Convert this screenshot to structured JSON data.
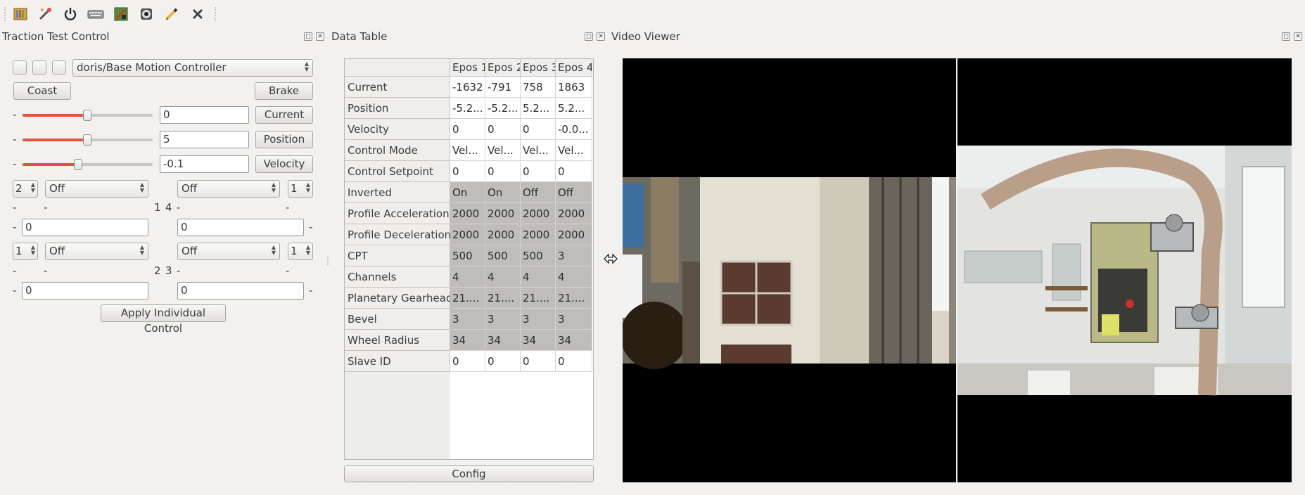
{
  "toolbar": {
    "icons": [
      "book-icon",
      "magic-wand-icon",
      "power-icon",
      "keyboard-icon",
      "terminal-icon",
      "webcam-icon",
      "pencil-icon",
      "close-icon"
    ]
  },
  "traction": {
    "title": "Traction Test Control",
    "controller": "doris/Base Motion Controller",
    "coast": "Coast",
    "brake": "Brake",
    "sliders": [
      {
        "minus": "-",
        "value": "0",
        "button": "Current",
        "level": 0.5
      },
      {
        "minus": "-",
        "value": "5",
        "button": "Position",
        "level": 0.5
      },
      {
        "minus": "-",
        "value": "-0.1",
        "button": "Velocity",
        "level": 0.43
      }
    ],
    "group1": {
      "spin_left": "2",
      "combo_left": "Off",
      "combo_right": "Off",
      "spin_right": "1",
      "dash_a": "-",
      "dash_b": "-",
      "label_left": "1",
      "label_right": "4",
      "dash_c": "-",
      "dash_d": "-",
      "input_minus": "-",
      "input_left": "0",
      "input_right": "0",
      "input_minus_right": "-"
    },
    "group2": {
      "spin_left": "1",
      "combo_left": "Off",
      "combo_right": "Off",
      "spin_right": "1",
      "dash_a": "-",
      "dash_b": "-",
      "label_left": "2",
      "label_right": "3",
      "dash_c": "-",
      "dash_d": "-",
      "input_minus": "-",
      "input_left": "0",
      "input_right": "0",
      "input_minus_right": "-"
    },
    "apply": "Apply Individual Control"
  },
  "data_table": {
    "title": "Data Table",
    "columns": [
      "Epos 1",
      "Epos 2",
      "Epos 3",
      "Epos 4"
    ],
    "rows": [
      {
        "label": "Current",
        "values": [
          "-1632",
          "-791",
          "758",
          "1863"
        ],
        "shaded": false
      },
      {
        "label": "Position",
        "values": [
          "-5.2...",
          "-5.2...",
          "5.2...",
          "5.2..."
        ],
        "shaded": false
      },
      {
        "label": "Velocity",
        "values": [
          "0",
          "0",
          "0",
          "-0.0..."
        ],
        "shaded": false
      },
      {
        "label": "Control Mode",
        "values": [
          "Vel...",
          "Vel...",
          "Vel...",
          "Vel..."
        ],
        "shaded": false
      },
      {
        "label": "Control Setpoint",
        "values": [
          "0",
          "0",
          "0",
          "0"
        ],
        "shaded": false
      },
      {
        "label": "Inverted",
        "values": [
          "On",
          "On",
          "Off",
          "Off"
        ],
        "shaded": true
      },
      {
        "label": "Profile Acceleration",
        "values": [
          "2000",
          "2000",
          "2000",
          "2000"
        ],
        "shaded": true
      },
      {
        "label": "Profile Deceleration",
        "values": [
          "2000",
          "2000",
          "2000",
          "2000"
        ],
        "shaded": true
      },
      {
        "label": "CPT",
        "values": [
          "500",
          "500",
          "500",
          "3"
        ],
        "shaded": true
      },
      {
        "label": "Channels",
        "values": [
          "4",
          "4",
          "4",
          "4"
        ],
        "shaded": true
      },
      {
        "label": "Planetary Gearhead",
        "values": [
          "21....",
          "21....",
          "21....",
          "21...."
        ],
        "shaded": true
      },
      {
        "label": "Bevel",
        "values": [
          "3",
          "3",
          "3",
          "3"
        ],
        "shaded": true
      },
      {
        "label": "Wheel Radius",
        "values": [
          "34",
          "34",
          "34",
          "34"
        ],
        "shaded": true
      },
      {
        "label": "Slave ID",
        "values": [
          "0",
          "0",
          "0",
          "0"
        ],
        "shaded": false
      }
    ],
    "config": "Config"
  },
  "video": {
    "title": "Video Viewer"
  }
}
